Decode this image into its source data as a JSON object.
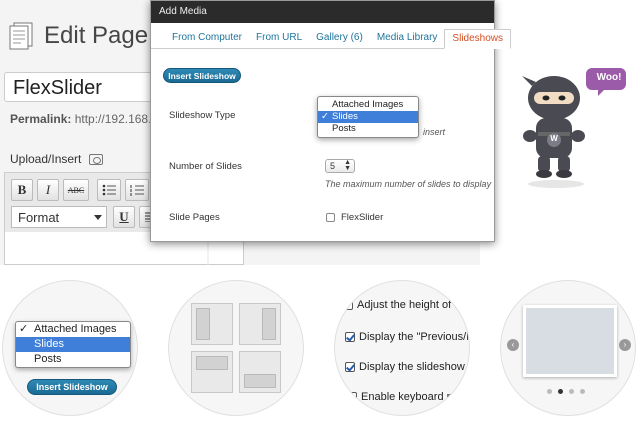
{
  "editor": {
    "title": "Edit Page",
    "post_title": "FlexSlider",
    "permalink_label": "Permalink:",
    "permalink_value": "http://192.168.",
    "upload_label": "Upload/Insert",
    "toolbar": {
      "bold": "B",
      "italic": "I",
      "strike": "ABC",
      "format": "Format",
      "underline": "U"
    }
  },
  "modal": {
    "title": "Add Media",
    "tabs": [
      {
        "label": "From Computer",
        "active": false
      },
      {
        "label": "From URL",
        "active": false
      },
      {
        "label": "Gallery (6)",
        "active": false
      },
      {
        "label": "Media Library",
        "active": false
      },
      {
        "label": "Slideshows",
        "active": true
      }
    ],
    "insert_button": "Insert Slideshow",
    "slideshow_type_label": "Slideshow Type",
    "type_options": [
      {
        "label": "Attached Images",
        "selected": false
      },
      {
        "label": "Slides",
        "selected": true
      },
      {
        "label": "Posts",
        "selected": false
      }
    ],
    "check_mark": "✓",
    "type_note_fragment": "insert",
    "number_of_slides_label": "Number of Slides",
    "number_of_slides_value": "5",
    "number_note": "The maximum number of slides to display",
    "slide_pages_label": "Slide Pages",
    "slide_pages_option": "FlexSlider"
  },
  "mascot": {
    "speech": "Woo!",
    "badge": "W",
    "colors": {
      "body": "#4a4a52",
      "face": "#f2dcc4",
      "bubble": "#9c5ba8"
    }
  },
  "features": {
    "dropdown_demo": {
      "options": [
        {
          "label": "Attached Images",
          "selected": false
        },
        {
          "label": "Slides",
          "selected": true
        },
        {
          "label": "Posts",
          "selected": false
        }
      ],
      "button": "Insert Slideshow"
    },
    "settings_demo": [
      {
        "label": "Adjust the height of the",
        "checked": false
      },
      {
        "label": "Display the \"Previous/Nex",
        "checked": true
      },
      {
        "label": "Display the slideshow pa",
        "checked": true
      },
      {
        "label": "Enable keyboard nav",
        "checked": false
      }
    ],
    "slider_demo": {
      "prev": "‹",
      "next": "›",
      "dot_count": 4,
      "active_dot": 2
    }
  },
  "colors": {
    "accent": "#21759b",
    "active_tab": "#d54e21",
    "selection": "#3f7fd9"
  }
}
